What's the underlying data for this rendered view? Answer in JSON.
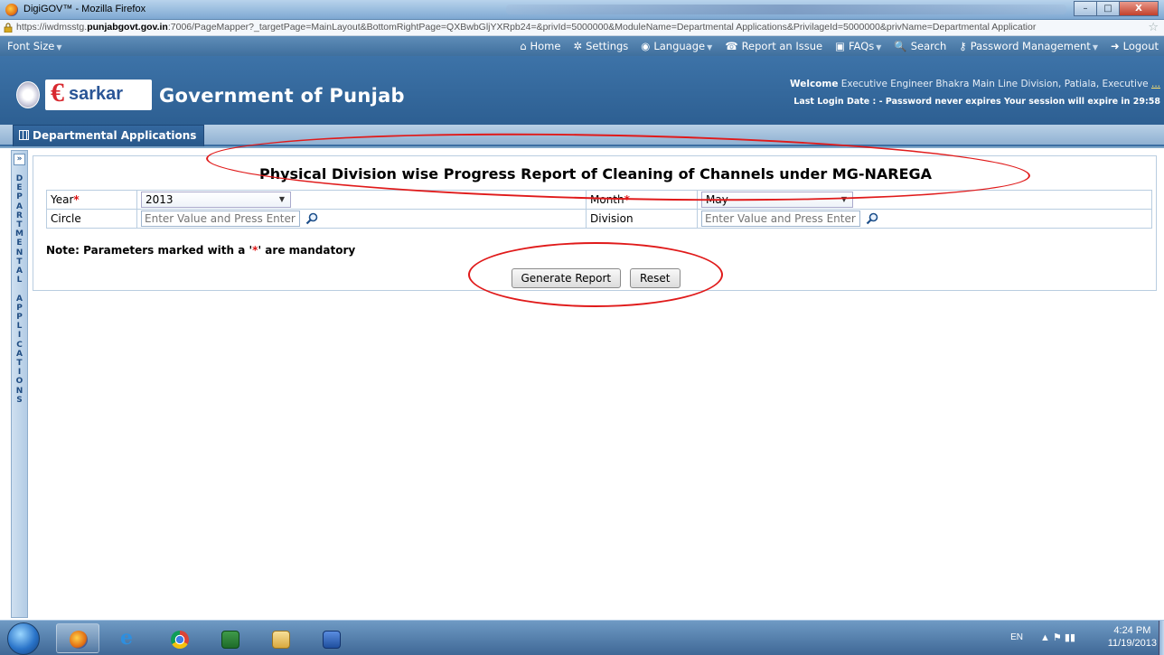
{
  "browser": {
    "title": "DigiGOV™ - Mozilla Firefox",
    "url_prefix": "https://iwdmsstg.",
    "url_domain": "punjabgovt.gov.in",
    "url_rest": ":7006/PageMapper?_targetPage=MainLayout&BottomRightPage=QXBwbGljYXRpb24=&privId=5000000&ModuleName=Departmental Applications&PrivilageId=5000000&privName=Departmental Applicatior",
    "window_buttons": [
      "–",
      "□",
      "X"
    ]
  },
  "topnav": {
    "font_size": "Font Size",
    "items": [
      {
        "icon": "home-icon",
        "glyph": "⌂",
        "label": "Home",
        "dropdown": false
      },
      {
        "icon": "settings-icon",
        "glyph": "✲",
        "label": "Settings",
        "dropdown": false
      },
      {
        "icon": "language-icon",
        "glyph": "◉",
        "label": "Language",
        "dropdown": true
      },
      {
        "icon": "phone-icon",
        "glyph": "☎",
        "label": "Report an Issue",
        "dropdown": false
      },
      {
        "icon": "faq-icon",
        "glyph": "▣",
        "label": "FAQs",
        "dropdown": true
      },
      {
        "icon": "search-icon",
        "glyph": "🔍",
        "label": "Search",
        "dropdown": false
      },
      {
        "icon": "key-icon",
        "glyph": "⚷",
        "label": "Password Management",
        "dropdown": true
      },
      {
        "icon": "logout-icon",
        "glyph": "➜",
        "label": "Logout",
        "dropdown": false
      }
    ]
  },
  "banner": {
    "logo_text": "sarkar",
    "government": "Government of Punjab",
    "welcome_label": "Welcome",
    "welcome_user": "Executive Engineer Bhakra Main Line Division, Patiala, Executive",
    "welcome_more": "...",
    "last_login": "Last Login Date : - Password never expires  Your session will expire in 29:58"
  },
  "tab": {
    "label": "Departmental Applications"
  },
  "sidebar": {
    "vertical_label": "DEPARTMENTAL APPLICATIONS",
    "expand_glyph": "»"
  },
  "report": {
    "title": "Physical Division wise Progress Report of Cleaning of Channels under MG-NAREGA",
    "fields": {
      "year_label": "Year",
      "year_value": "2013",
      "month_label": "Month",
      "month_value": "May",
      "circle_label": "Circle",
      "circle_placeholder": "Enter Value and Press Enter",
      "division_label": "Division",
      "division_placeholder": "Enter Value and Press Enter"
    },
    "required_marker": "*",
    "note_prefix": "Note: Parameters marked with a '",
    "note_marker": "*",
    "note_suffix": "' are mandatory",
    "generate_button": "Generate Report",
    "reset_button": "Reset"
  },
  "taskbar": {
    "language": "EN",
    "time": "4:24 PM",
    "date": "11/19/2013"
  }
}
